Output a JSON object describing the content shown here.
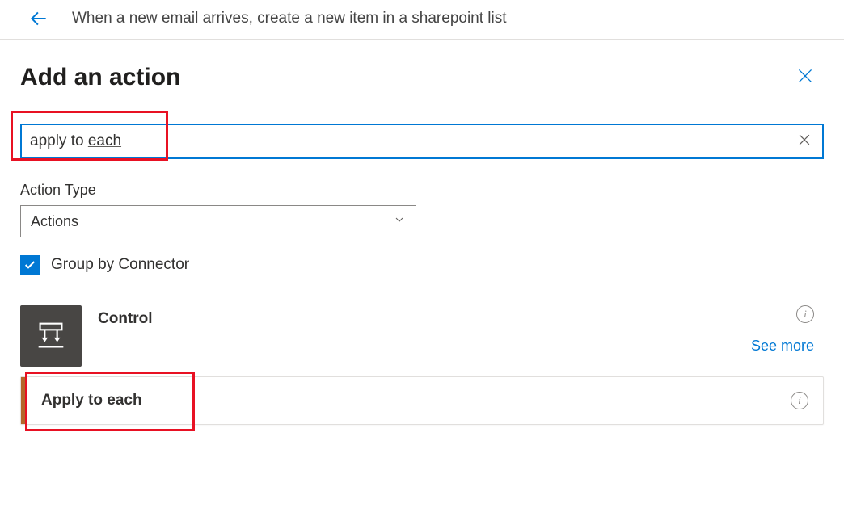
{
  "header": {
    "breadcrumb": "When a new email arrives, create a new item in a sharepoint list"
  },
  "panel": {
    "title": "Add an action",
    "search_value_prefix": "apply to ",
    "search_value_last": "each",
    "action_type_label": "Action Type",
    "action_type_value": "Actions",
    "group_by_label": "Group by Connector"
  },
  "results": {
    "connector_name": "Control",
    "see_more": "See more",
    "action_name": "Apply to each"
  }
}
